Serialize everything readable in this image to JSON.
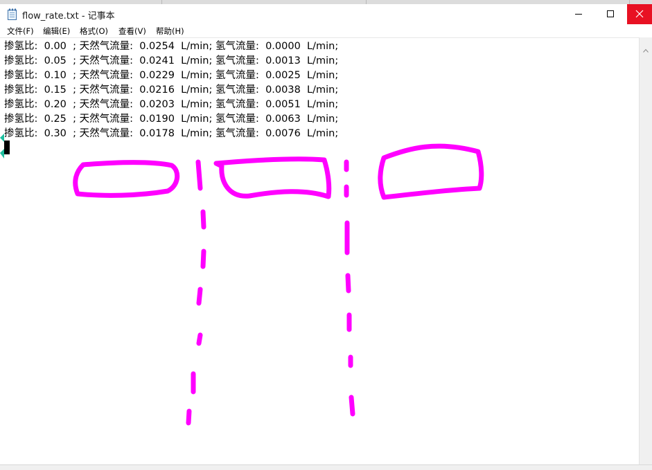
{
  "window": {
    "title": "flow_rate.txt - 记事本",
    "minimize_symbol": "—",
    "maximize_symbol": "☐",
    "close_symbol": "✕",
    "icons": [
      "notepad-icon",
      "minimize-icon",
      "maximize-icon",
      "close-icon",
      "chevron-up-icon"
    ]
  },
  "menu": {
    "file": "文件(F)",
    "edit": "编辑(E)",
    "format": "格式(O)",
    "view": "查看(V)",
    "help": "帮助(H)"
  },
  "lines": [
    "掺氢比:  0.00  ; 天然气流量:  0.0254  L/min; 氢气流量:  0.0000  L/min;",
    "掺氢比:  0.05  ; 天然气流量:  0.0241  L/min; 氢气流量:  0.0013  L/min;",
    "掺氢比:  0.10  ; 天然气流量:  0.0229  L/min; 氢气流量:  0.0025  L/min;",
    "掺氢比:  0.15  ; 天然气流量:  0.0216  L/min; 氢气流量:  0.0038  L/min;",
    "掺氢比:  0.20  ; 天然气流量:  0.0203  L/min; 氢气流量:  0.0051  L/min;",
    "掺氢比:  0.25  ; 天然气流量:  0.0190  L/min; 氢气流量:  0.0063  L/min;",
    "掺氢比:  0.30  ; 天然气流量:  0.0178  L/min; 氢气流量:  0.0076  L/min;"
  ],
  "colors": {
    "annotation": "#ff00ff",
    "close_button": "#e81123",
    "text": "#000000",
    "left_marker": "#1fbf9f"
  }
}
